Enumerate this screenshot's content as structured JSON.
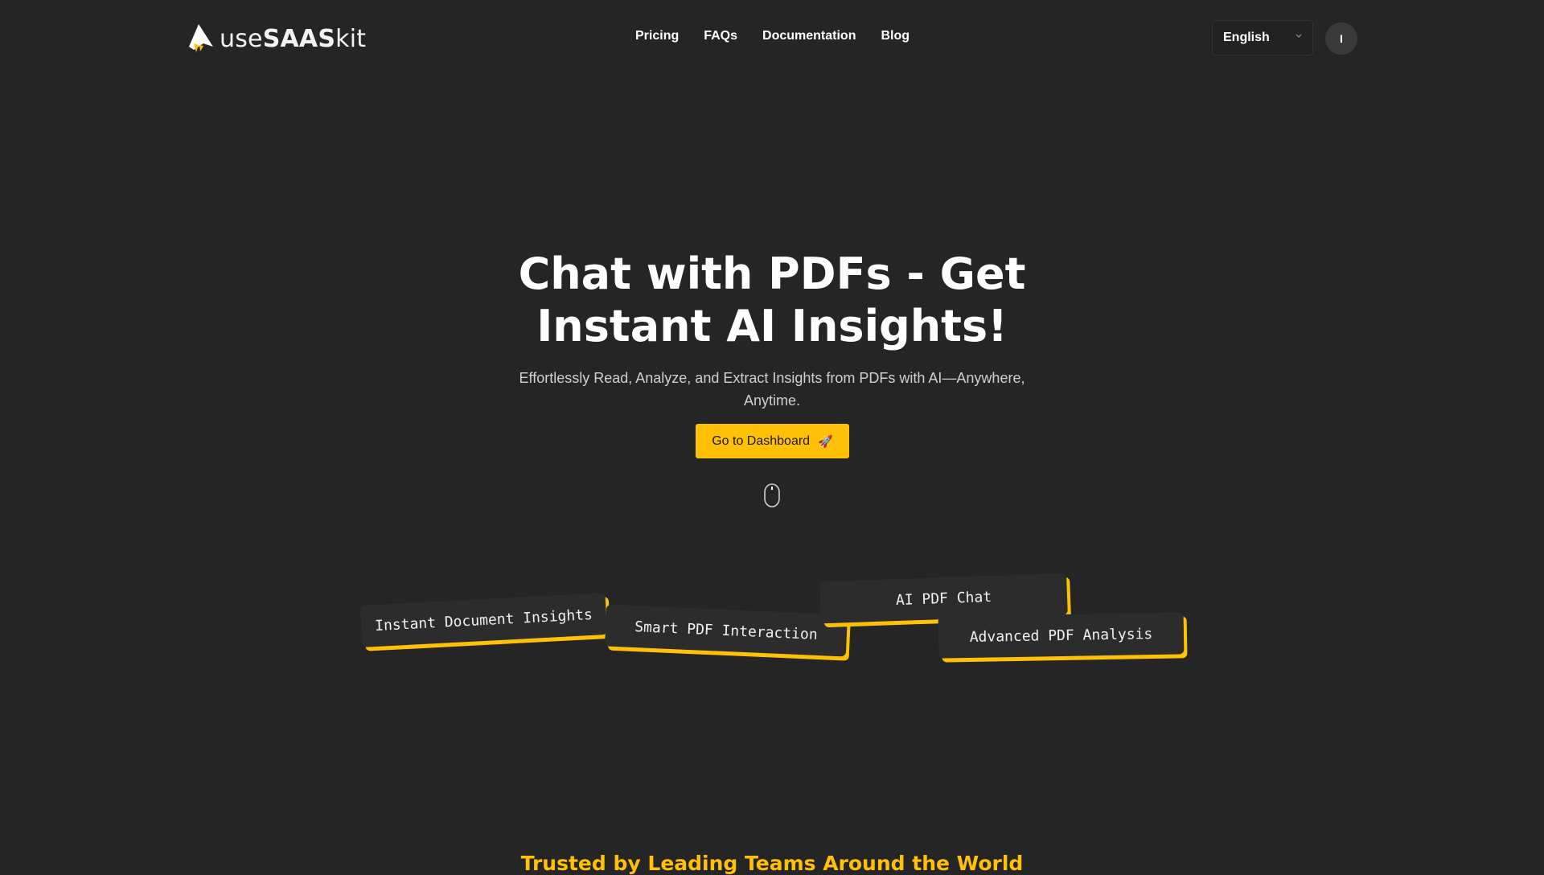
{
  "brand": {
    "logo_light": "use",
    "logo_bold": "SAAS",
    "logo_suffix": "kit",
    "accent_color": "#ffc107"
  },
  "nav": {
    "links": [
      {
        "label": "Pricing"
      },
      {
        "label": "FAQs"
      },
      {
        "label": "Documentation"
      },
      {
        "label": "Blog"
      }
    ],
    "language": {
      "selected": "English"
    },
    "avatar_initial": "I"
  },
  "hero": {
    "title_line1": "Chat with PDFs - Get",
    "title_line2": "Instant AI Insights!",
    "subtitle": "Effortlessly Read, Analyze, and Extract Insights from PDFs with AI—Anywhere, Anytime.",
    "cta_label": "Go to Dashboard",
    "cta_icon": "🚀"
  },
  "feature_cards": [
    {
      "label": "Instant Document Insights"
    },
    {
      "label": "Smart PDF Interaction"
    },
    {
      "label": "AI PDF Chat"
    },
    {
      "label": "Advanced PDF Analysis"
    }
  ],
  "trusted": {
    "heading": "Trusted by Leading Teams Around the World"
  }
}
